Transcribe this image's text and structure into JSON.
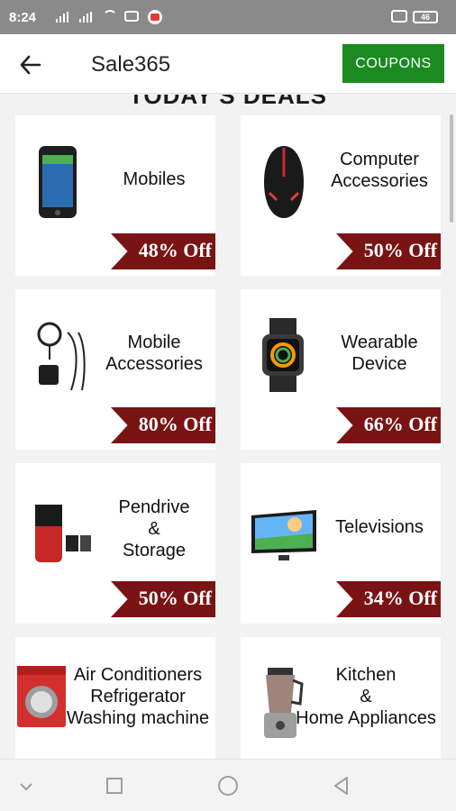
{
  "status_bar": {
    "time": "8:24",
    "battery": "46"
  },
  "app_bar": {
    "title": "Sale365",
    "coupons_label": "COUPONS"
  },
  "section": {
    "title": "TODAY'S DEALS"
  },
  "deals": [
    {
      "lines": [
        "Mobiles"
      ],
      "discount": "48% Off",
      "icon": "smartphone-icon"
    },
    {
      "lines": [
        "Computer",
        "Accessories"
      ],
      "discount": "50% Off",
      "icon": "gaming-mouse-icon"
    },
    {
      "lines": [
        "Mobile",
        "Accessories"
      ],
      "discount": "80% Off",
      "icon": "charger-earphones-icon"
    },
    {
      "lines": [
        "Wearable",
        "Device"
      ],
      "discount": "66% Off",
      "icon": "smartwatch-icon"
    },
    {
      "lines": [
        "Pendrive",
        "&",
        "Storage"
      ],
      "discount": "50% Off",
      "icon": "pendrive-icon"
    },
    {
      "lines": [
        "Televisions"
      ],
      "discount": "34% Off",
      "icon": "television-icon"
    },
    {
      "lines": [
        "Air Conditioners",
        "Refrigerator",
        "Washing machine"
      ],
      "discount": "",
      "icon": "washing-machine-icon"
    },
    {
      "lines": [
        "Kitchen",
        "&",
        "Home Appliances"
      ],
      "discount": "",
      "icon": "blender-icon"
    }
  ],
  "colors": {
    "accent": "#1b8a21",
    "ribbon": "#7a1414",
    "status_bar": "#8a8a8a"
  }
}
